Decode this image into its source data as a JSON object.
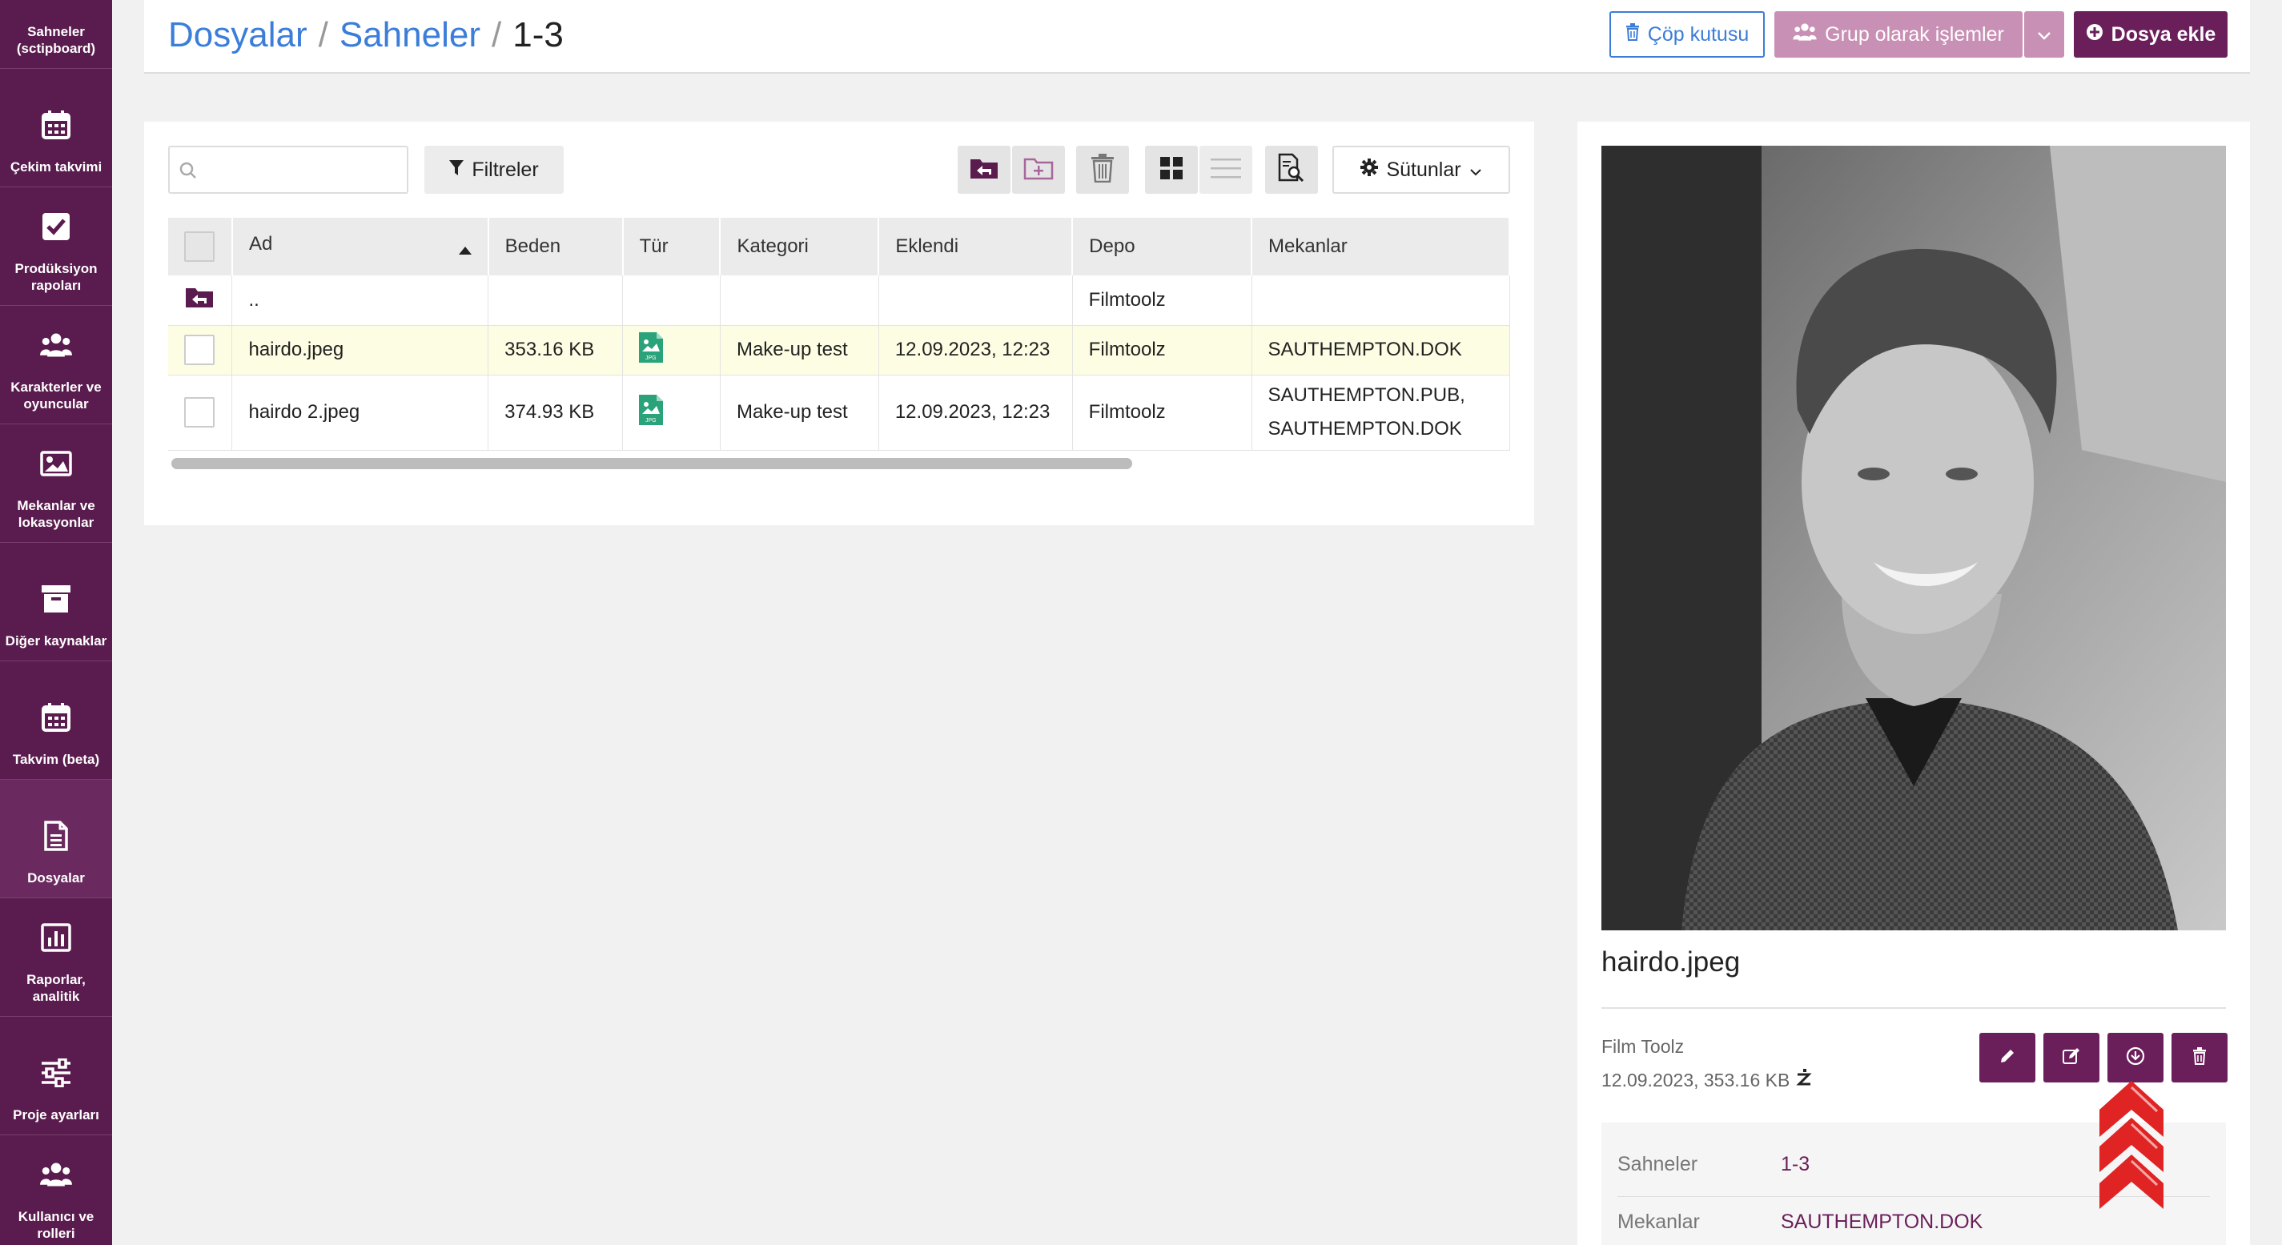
{
  "sidebar": {
    "items": [
      {
        "label": "Sahneler (sctipboard)",
        "icon": "scenes-icon"
      },
      {
        "label": "Çekim takvimi",
        "icon": "calendar-icon"
      },
      {
        "label": "Prodüksiyon rapoları",
        "icon": "checkbox-icon"
      },
      {
        "label": "Karakterler ve oyuncular",
        "icon": "users-icon"
      },
      {
        "label": "Mekanlar ve lokasyonlar",
        "icon": "image-icon"
      },
      {
        "label": "Diğer kaynaklar",
        "icon": "archive-icon"
      },
      {
        "label": "Takvim (beta)",
        "icon": "calendar-icon"
      },
      {
        "label": "Dosyalar",
        "icon": "file-icon"
      },
      {
        "label": "Raporlar, analitik",
        "icon": "bar-chart-icon"
      },
      {
        "label": "Proje ayarları",
        "icon": "sliders-icon"
      },
      {
        "label": "Kullanıcı ve rolleri",
        "icon": "users-icon"
      }
    ]
  },
  "header": {
    "breadcrumb": [
      "Dosyalar",
      "Sahneler",
      "1-3"
    ],
    "separator": "/",
    "trash_label": "Çöp kutusu",
    "group_label": "Grup olarak işlemler",
    "add_label": "Dosya ekle"
  },
  "toolbar": {
    "search_placeholder": "",
    "filters_label": "Filtreler",
    "columns_label": "Sütunlar"
  },
  "table": {
    "headers": [
      "Ad",
      "Beden",
      "Tür",
      "Kategori",
      "Eklendi",
      "Depo",
      "Mekanlar"
    ],
    "parent_row": {
      "name": "..",
      "depo": "Filmtoolz"
    },
    "rows": [
      {
        "name": "hairdo.jpeg",
        "size": "353.16 KB",
        "type": "JPG",
        "category": "Make-up test",
        "added": "12.09.2023, 12:23",
        "depo": "Filmtoolz",
        "locations": [
          "SAUTHEMPTON.DOK"
        ]
      },
      {
        "name": "hairdo 2.jpeg",
        "size": "374.93 KB",
        "type": "JPG",
        "category": "Make-up test",
        "added": "12.09.2023, 12:23",
        "depo": "Filmtoolz",
        "locations": [
          "SAUTHEMPTON.PUB,",
          "SAUTHEMPTON.DOK"
        ]
      }
    ]
  },
  "preview": {
    "file_name": "hairdo.jpeg",
    "source": "Film Toolz",
    "date_size": "12.09.2023, 353.16 KB",
    "info": [
      {
        "key": "Sahneler",
        "value": "1-3"
      },
      {
        "key": "Mekanlar",
        "value": "SAUTHEMPTON.DOK"
      }
    ]
  },
  "colors": {
    "sidebar": "#5a1c4e",
    "accent": "#6b1f5a",
    "link": "#3b7dd8",
    "arrow_overlay": "#e02424"
  }
}
